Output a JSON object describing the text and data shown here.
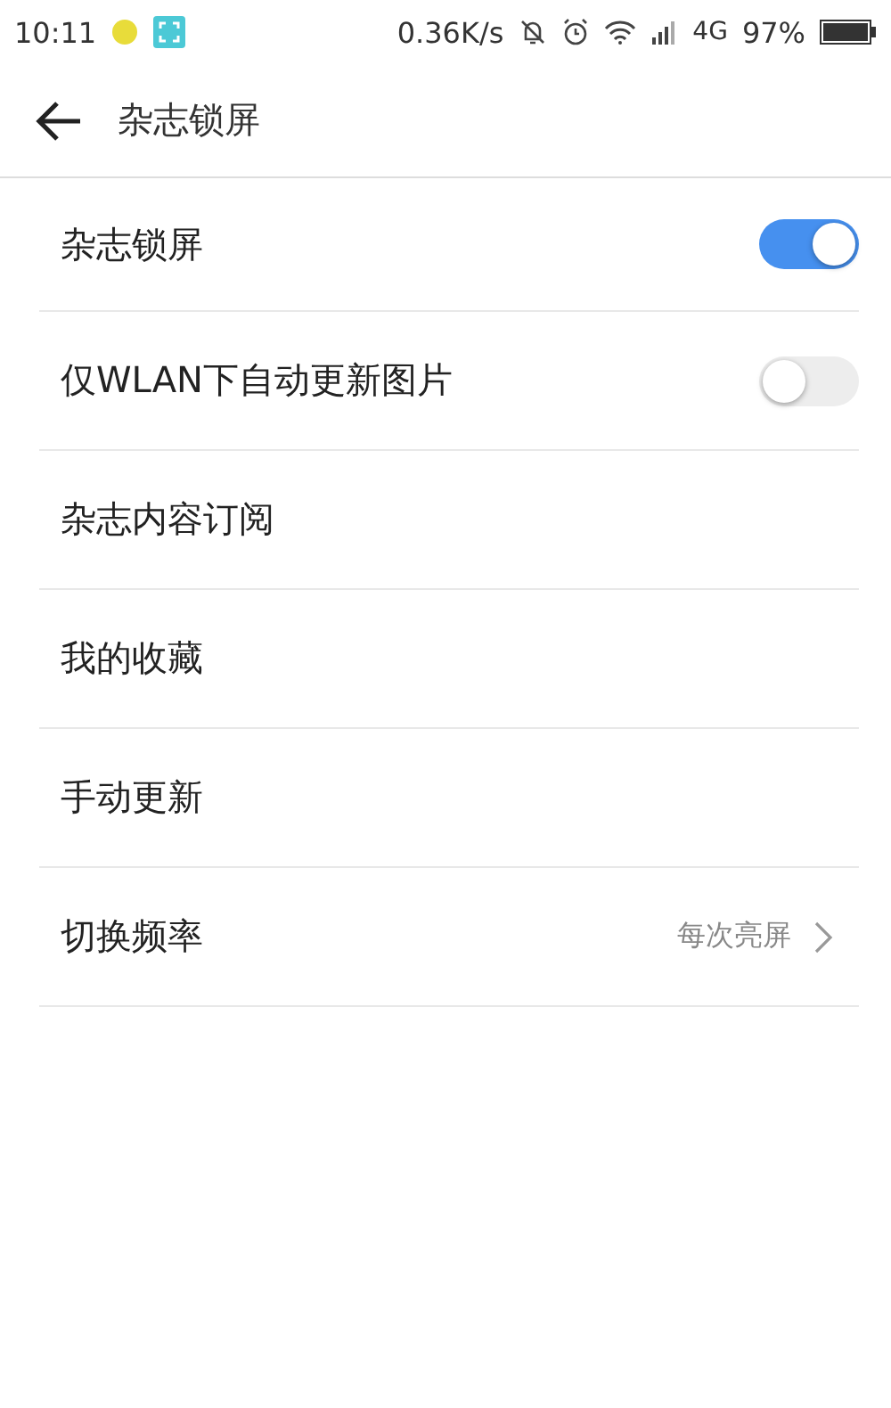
{
  "status_bar": {
    "time": "10:11",
    "speed": "0.36K/s",
    "network": "4G",
    "battery": "97%"
  },
  "header": {
    "title": "杂志锁屏"
  },
  "items": [
    {
      "kind": "toggle",
      "label": "杂志锁屏",
      "on": true
    },
    {
      "kind": "toggle",
      "label": "仅WLAN下自动更新图片",
      "on": false
    },
    {
      "kind": "plain",
      "label": "杂志内容订阅"
    },
    {
      "kind": "plain",
      "label": "我的收藏"
    },
    {
      "kind": "plain",
      "label": "手动更新"
    },
    {
      "kind": "value",
      "label": "切换频率",
      "value": "每次亮屏"
    }
  ]
}
